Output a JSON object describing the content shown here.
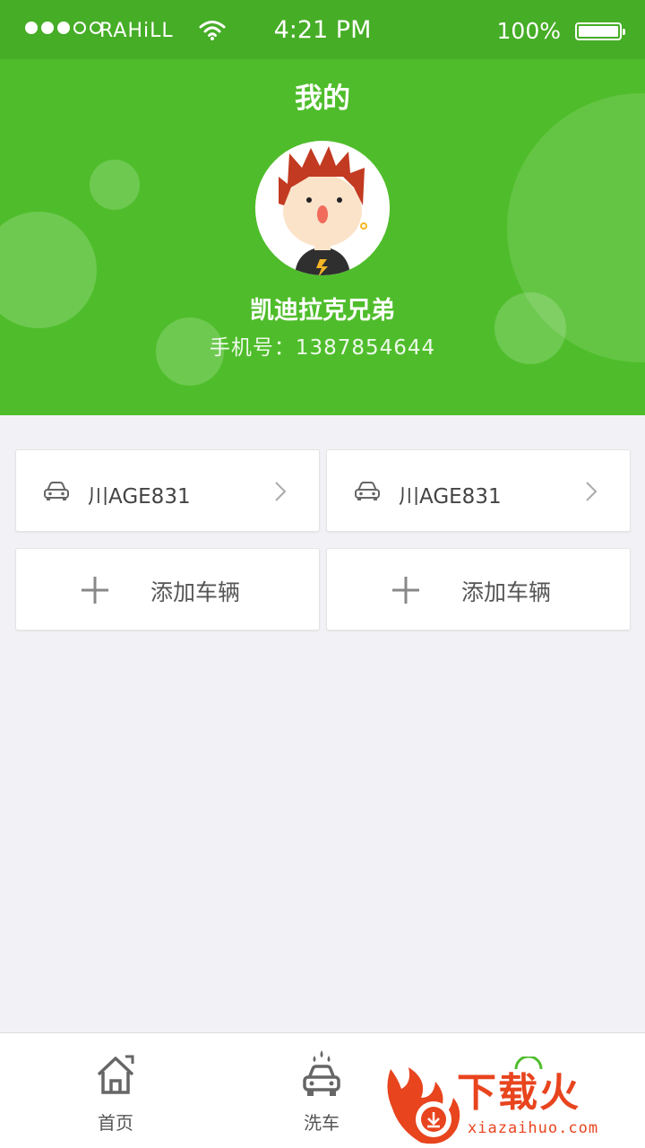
{
  "status_bar": {
    "carrier": "RAHiLL",
    "time": "4:21 PM",
    "battery": "100%"
  },
  "header": {
    "title": "我的"
  },
  "profile": {
    "name": "凯迪拉克兄弟",
    "phone": "手机号：1387854644"
  },
  "vehicles": [
    {
      "plate": "川AGE831"
    },
    {
      "plate": "川AGE831"
    }
  ],
  "add_vehicle": [
    {
      "label": "添加车辆"
    },
    {
      "label": "添加车辆"
    }
  ],
  "tabs": [
    {
      "label": "首页",
      "icon": "home-icon"
    },
    {
      "label": "洗车",
      "icon": "car-wash-icon"
    },
    {
      "label": "",
      "icon": "profile-icon"
    }
  ],
  "watermark": {
    "text": "下载火",
    "domain": "xiazaihuo.com"
  },
  "colors": {
    "header_green": "#4fbd2b",
    "status_green": "#46ad26",
    "background": "#f2f2f6",
    "watermark": "#e8441e"
  }
}
